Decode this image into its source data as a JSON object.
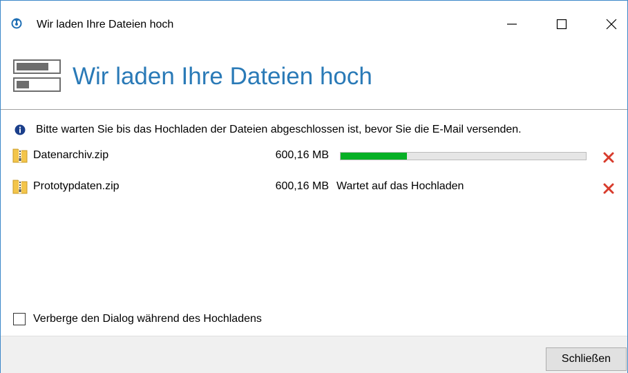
{
  "window": {
    "title": "Wir laden Ihre Dateien hoch",
    "accent_color": "#2a7ab7",
    "icons": {
      "app": "upload-app-icon",
      "minimize": "minimize-icon",
      "maximize": "maximize-icon",
      "close": "close-icon"
    }
  },
  "header": {
    "title": "Wir laden Ihre Dateien hoch",
    "icon": "upload-progress-icon"
  },
  "info": {
    "icon": "info-icon",
    "text": "Bitte warten Sie bis das Hochladen der Dateien abgeschlossen ist, bevor Sie die E-Mail versenden."
  },
  "files": [
    {
      "name": "Datenarchiv.zip",
      "size": "600,16 MB",
      "status": "",
      "progress_percent": 27,
      "progress_color": "#06b025",
      "icon": "zip-folder-icon",
      "remove_icon": "remove-x-icon"
    },
    {
      "name": "Prototypdaten.zip",
      "size": "600,16 MB",
      "status": "Wartet auf das Hochladen",
      "icon": "zip-folder-icon",
      "remove_icon": "remove-x-icon"
    }
  ],
  "options": {
    "hide_dialog_label": "Verberge den Dialog während des Hochladens",
    "hide_dialog_checked": false
  },
  "footer": {
    "close_label": "Schließen"
  }
}
